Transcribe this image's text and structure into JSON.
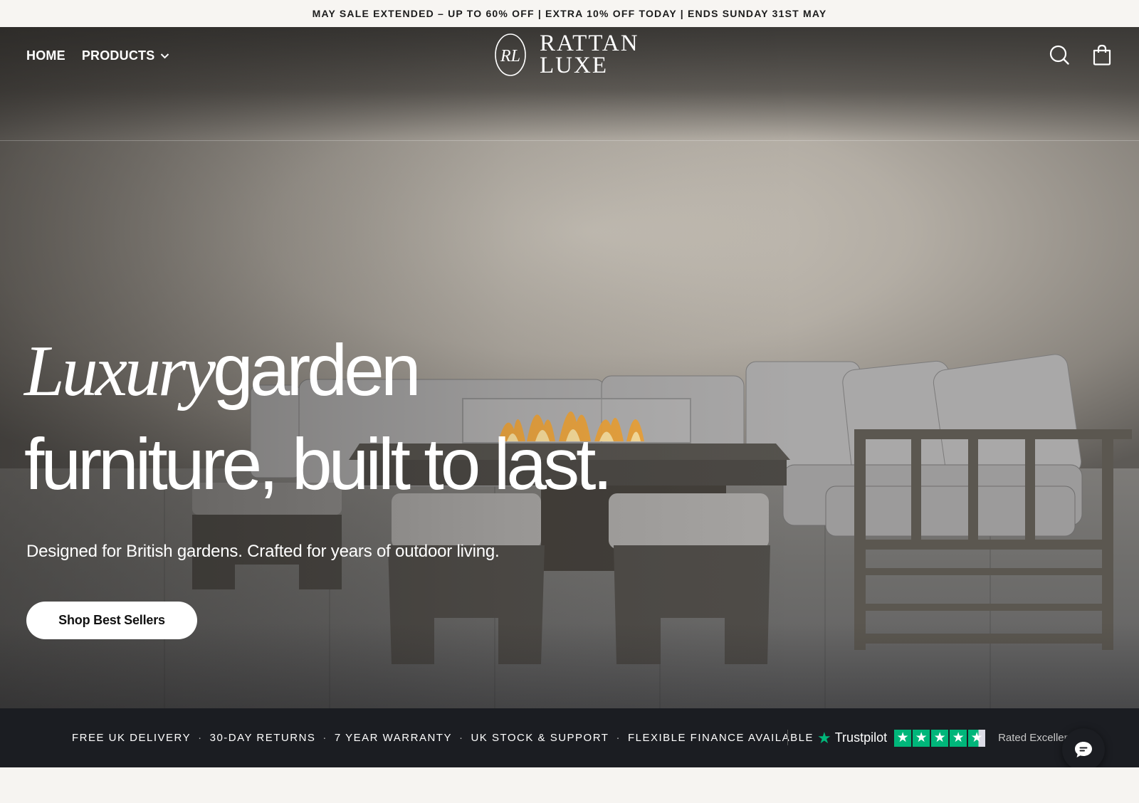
{
  "announcement": "MAY SALE EXTENDED – UP TO 60% OFF | EXTRA 10% OFF TODAY | ENDS SUNDAY 31ST MAY",
  "nav": {
    "home": "HOME",
    "products": "PRODUCTS"
  },
  "logo": {
    "line1": "RATTAN",
    "line2": "LUXE",
    "monogram": "RL"
  },
  "icons": {
    "search": "search-icon",
    "cart": "shopping-bag-icon",
    "chat": "chat-icon"
  },
  "hero": {
    "headline_script": "Luxury",
    "headline_1": "garden",
    "headline_2": "furniture, built to last.",
    "subheadline": "Designed for British gardens. Crafted for years of outdoor living.",
    "cta": "Shop Best Sellers"
  },
  "trust_bar": {
    "items": [
      "FREE UK DELIVERY",
      "30-DAY RETURNS",
      "7 YEAR WARRANTY",
      "UK STOCK & SUPPORT",
      "FLEXIBLE FINANCE AVAILABLE"
    ],
    "separator": "·",
    "trustpilot": {
      "brand": "Trustpilot",
      "rating_stars": 4.5,
      "rated_text": "Rated Excellent"
    }
  },
  "colors": {
    "trust_bar_bg": "#1b1d22",
    "trustpilot_green": "#00b67a",
    "announcement_bg": "#f7f5f2"
  }
}
